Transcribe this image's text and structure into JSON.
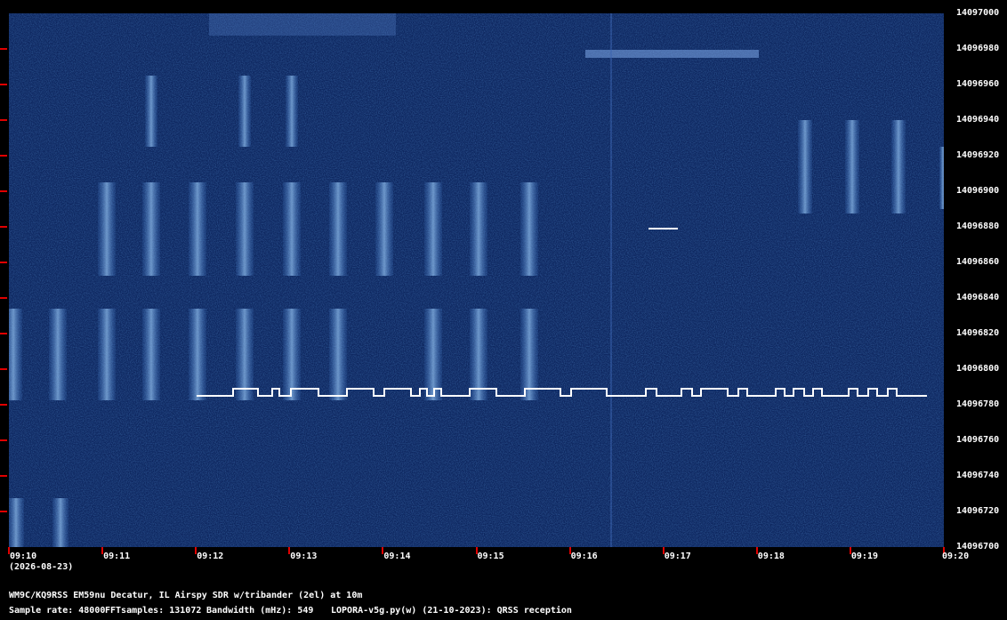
{
  "chart_data": {
    "type": "heatmap",
    "y_axis": {
      "min": 14096700,
      "max": 14097000,
      "step": 20,
      "labels": [
        "14097000",
        "14096980",
        "14096960",
        "14096940",
        "14096920",
        "14096900",
        "14096880",
        "14096860",
        "14096840",
        "14096820",
        "14096800",
        "14096780",
        "14096760",
        "14096740",
        "14096720",
        "14096700"
      ]
    },
    "x_axis": {
      "labels": [
        "09:10",
        "09:11",
        "09:12",
        "09:13",
        "09:14",
        "09:15",
        "09:16",
        "09:17",
        "09:18",
        "09:19",
        "09:20"
      ],
      "range": [
        "09:10",
        "09:20"
      ]
    },
    "colors": {
      "background": "#0e2760",
      "signal": "#8ec2ff",
      "trace": "#ffffff",
      "ticks": "#e00000"
    }
  },
  "date_label": "(2026-08-23)",
  "info": {
    "station": "WM9C/KQ9RSS EM59nu Decatur, IL  Airspy SDR w/tribander (2el) at 10m",
    "sample_rate": "Sample rate: 48000",
    "fft_samples": "FFTsamples: 131072",
    "bandwidth": "Bandwidth (mHz): 549",
    "software": "LOPORA-v5g.py(w) (21-10-2023): QRSS reception"
  }
}
